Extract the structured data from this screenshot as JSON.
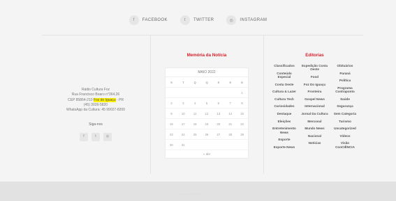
{
  "social": [
    {
      "icon": "facebook-icon",
      "glyph": "f",
      "label": "FACEBOOK"
    },
    {
      "icon": "twitter-icon",
      "glyph": "t",
      "label": "TWITTER"
    },
    {
      "icon": "instagram-icon",
      "glyph": "◎",
      "label": "INSTAGRAM"
    }
  ],
  "contact": {
    "name": "Rádio Cultura Foz",
    "address": "Rua Francisco Boaro n°364,26",
    "cep_prefix": "CEP 85864-210 ",
    "city_highlight": "Foz do Iguaçu",
    "cep_suffix": " - PR",
    "phone": "(45) 3026-5820",
    "whatsapp": "WhatsApp da Cultura: 45 99027-8200",
    "follow_label": "Siga-nos",
    "icons": [
      {
        "icon": "facebook-icon",
        "glyph": "f"
      },
      {
        "icon": "twitter-icon",
        "glyph": "t"
      },
      {
        "icon": "instagram-icon",
        "glyph": "◎"
      }
    ]
  },
  "archive": {
    "title": "Memória da Notícia",
    "month": "MAIO 2022",
    "weekdays": [
      "S",
      "T",
      "Q",
      "Q",
      "S",
      "S",
      "D"
    ],
    "weeks": [
      [
        "",
        "",
        "",
        "",
        "",
        "",
        "1"
      ],
      [
        "2",
        "3",
        "4",
        "5",
        "6",
        "7",
        "8"
      ],
      [
        "9",
        "10",
        "11",
        "12",
        "13",
        "14",
        "15"
      ],
      [
        "16",
        "17",
        "18",
        "19",
        "20",
        "21",
        "22"
      ],
      [
        "23",
        "24",
        "25",
        "26",
        "27",
        "28",
        "29"
      ],
      [
        "30",
        "31",
        "",
        "",
        "",
        "",
        ""
      ]
    ],
    "prev_link": "« abr"
  },
  "editorias": {
    "title": "Editorias",
    "columns": [
      [
        "Classificados",
        "Conteúdo Especial",
        "Costa Oeste",
        "Cultura & Lazer",
        "Cultura Tech",
        "Curiosidades",
        "Destaque",
        "Eleições",
        "Entretenimento News",
        "Esporte",
        "Esporte News"
      ],
      [
        "Expedição Costa Oeste",
        "Food",
        "Foz Do Iguaçu",
        "Fronteira",
        "Gospel News",
        "Internacional",
        "Jornal Da Cultura",
        "Mercosul",
        "Mundo News",
        "Nacional",
        "Notícias"
      ],
      [
        "Obituários",
        "Paraná",
        "Política",
        "Programa Contraponto",
        "Saúde",
        "Segurança",
        "Sem Categoria",
        "Turismo",
        "Uncategorized",
        "Vídeos",
        "Visão ConCIÊNCIA"
      ]
    ]
  }
}
